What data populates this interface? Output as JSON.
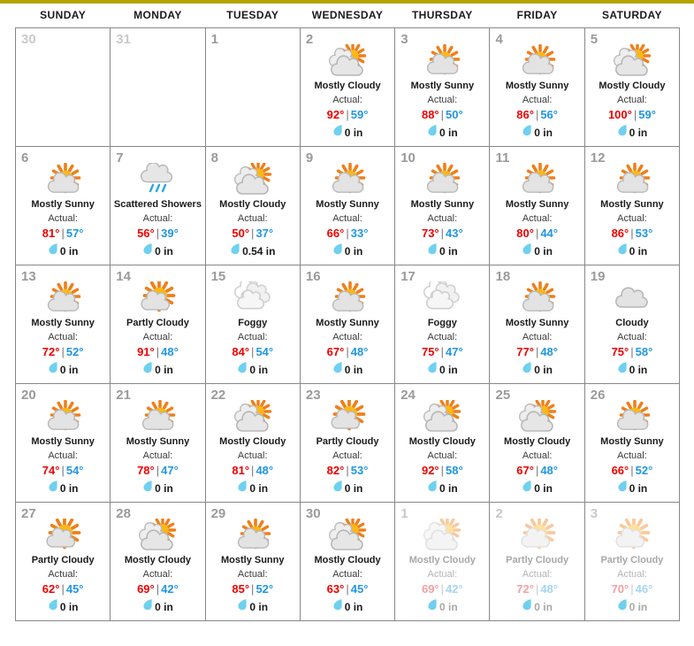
{
  "theme": {
    "topbar_color": "#b5a400",
    "high_temp_color": "#ee0000",
    "low_temp_color": "#2196e3",
    "muted_bg_color": "#eaeaea",
    "grid_border_color": "#888888"
  },
  "header": {
    "weekdays": [
      "SUNDAY",
      "MONDAY",
      "TUESDAY",
      "WEDNESDAY",
      "THURSDAY",
      "FRIDAY",
      "SATURDAY"
    ]
  },
  "labels": {
    "actual": "Actual:",
    "precip_unit": "in"
  },
  "weeks": [
    [
      {
        "day": "30",
        "muted": true,
        "empty": true
      },
      {
        "day": "31",
        "muted": true,
        "empty": true
      },
      {
        "day": "1",
        "muted": false,
        "empty": true
      },
      {
        "day": "2",
        "muted": false,
        "empty": false,
        "condition": "Mostly Cloudy",
        "icon": "mostly-cloudy-icon",
        "actual": "Actual:",
        "high": "92°",
        "low": "59°",
        "precip": "0 in"
      },
      {
        "day": "3",
        "muted": false,
        "empty": false,
        "condition": "Mostly Sunny",
        "icon": "mostly-sunny-icon",
        "actual": "Actual:",
        "high": "88°",
        "low": "50°",
        "precip": "0 in"
      },
      {
        "day": "4",
        "muted": false,
        "empty": false,
        "condition": "Mostly Sunny",
        "icon": "mostly-sunny-icon",
        "actual": "Actual:",
        "high": "86°",
        "low": "56°",
        "precip": "0 in"
      },
      {
        "day": "5",
        "muted": false,
        "empty": false,
        "condition": "Mostly Cloudy",
        "icon": "mostly-cloudy-icon",
        "actual": "Actual:",
        "high": "100°",
        "low": "59°",
        "precip": "0 in"
      }
    ],
    [
      {
        "day": "6",
        "muted": false,
        "empty": false,
        "condition": "Mostly Sunny",
        "icon": "mostly-sunny-icon",
        "actual": "Actual:",
        "high": "81°",
        "low": "57°",
        "precip": "0 in"
      },
      {
        "day": "7",
        "muted": false,
        "empty": false,
        "condition": "Scattered Showers",
        "icon": "scattered-showers-icon",
        "actual": "Actual:",
        "high": "56°",
        "low": "39°",
        "precip": "0 in"
      },
      {
        "day": "8",
        "muted": false,
        "empty": false,
        "condition": "Mostly Cloudy",
        "icon": "mostly-cloudy-icon",
        "actual": "Actual:",
        "high": "50°",
        "low": "37°",
        "precip": "0.54 in"
      },
      {
        "day": "9",
        "muted": false,
        "empty": false,
        "condition": "Mostly Sunny",
        "icon": "mostly-sunny-icon",
        "actual": "Actual:",
        "high": "66°",
        "low": "33°",
        "precip": "0 in"
      },
      {
        "day": "10",
        "muted": false,
        "empty": false,
        "condition": "Mostly Sunny",
        "icon": "mostly-sunny-icon",
        "actual": "Actual:",
        "high": "73°",
        "low": "43°",
        "precip": "0 in"
      },
      {
        "day": "11",
        "muted": false,
        "empty": false,
        "condition": "Mostly Sunny",
        "icon": "mostly-sunny-icon",
        "actual": "Actual:",
        "high": "80°",
        "low": "44°",
        "precip": "0 in"
      },
      {
        "day": "12",
        "muted": false,
        "empty": false,
        "condition": "Mostly Sunny",
        "icon": "mostly-sunny-icon",
        "actual": "Actual:",
        "high": "86°",
        "low": "53°",
        "precip": "0 in"
      }
    ],
    [
      {
        "day": "13",
        "muted": false,
        "empty": false,
        "condition": "Mostly Sunny",
        "icon": "mostly-sunny-icon",
        "actual": "Actual:",
        "high": "72°",
        "low": "52°",
        "precip": "0 in"
      },
      {
        "day": "14",
        "muted": false,
        "empty": false,
        "condition": "Partly Cloudy",
        "icon": "partly-cloudy-icon",
        "actual": "Actual:",
        "high": "91°",
        "low": "48°",
        "precip": "0 in"
      },
      {
        "day": "15",
        "muted": false,
        "empty": false,
        "condition": "Foggy",
        "icon": "foggy-icon",
        "actual": "Actual:",
        "high": "84°",
        "low": "54°",
        "precip": "0 in"
      },
      {
        "day": "16",
        "muted": false,
        "empty": false,
        "condition": "Mostly Sunny",
        "icon": "mostly-sunny-icon",
        "actual": "Actual:",
        "high": "67°",
        "low": "48°",
        "precip": "0 in"
      },
      {
        "day": "17",
        "muted": false,
        "empty": false,
        "condition": "Foggy",
        "icon": "foggy-icon",
        "actual": "Actual:",
        "high": "75°",
        "low": "47°",
        "precip": "0 in"
      },
      {
        "day": "18",
        "muted": false,
        "empty": false,
        "condition": "Mostly Sunny",
        "icon": "mostly-sunny-icon",
        "actual": "Actual:",
        "high": "77°",
        "low": "48°",
        "precip": "0 in"
      },
      {
        "day": "19",
        "muted": false,
        "empty": false,
        "condition": "Cloudy",
        "icon": "cloudy-icon",
        "actual": "Actual:",
        "high": "75°",
        "low": "58°",
        "precip": "0 in"
      }
    ],
    [
      {
        "day": "20",
        "muted": false,
        "empty": false,
        "condition": "Mostly Sunny",
        "icon": "mostly-sunny-icon",
        "actual": "Actual:",
        "high": "74°",
        "low": "54°",
        "precip": "0 in"
      },
      {
        "day": "21",
        "muted": false,
        "empty": false,
        "condition": "Mostly Sunny",
        "icon": "mostly-sunny-icon",
        "actual": "Actual:",
        "high": "78°",
        "low": "47°",
        "precip": "0 in"
      },
      {
        "day": "22",
        "muted": false,
        "empty": false,
        "condition": "Mostly Cloudy",
        "icon": "mostly-cloudy-icon",
        "actual": "Actual:",
        "high": "81°",
        "low": "48°",
        "precip": "0 in"
      },
      {
        "day": "23",
        "muted": false,
        "empty": false,
        "condition": "Partly Cloudy",
        "icon": "partly-cloudy-icon",
        "actual": "Actual:",
        "high": "82°",
        "low": "53°",
        "precip": "0 in"
      },
      {
        "day": "24",
        "muted": false,
        "empty": false,
        "condition": "Mostly Cloudy",
        "icon": "mostly-cloudy-icon",
        "actual": "Actual:",
        "high": "92°",
        "low": "58°",
        "precip": "0 in"
      },
      {
        "day": "25",
        "muted": false,
        "empty": false,
        "condition": "Mostly Cloudy",
        "icon": "mostly-cloudy-icon",
        "actual": "Actual:",
        "high": "67°",
        "low": "48°",
        "precip": "0 in"
      },
      {
        "day": "26",
        "muted": false,
        "empty": false,
        "condition": "Mostly Sunny",
        "icon": "mostly-sunny-icon",
        "actual": "Actual:",
        "high": "66°",
        "low": "52°",
        "precip": "0 in"
      }
    ],
    [
      {
        "day": "27",
        "muted": false,
        "empty": false,
        "condition": "Partly Cloudy",
        "icon": "partly-cloudy-icon",
        "actual": "Actual:",
        "high": "62°",
        "low": "45°",
        "precip": "0 in"
      },
      {
        "day": "28",
        "muted": false,
        "empty": false,
        "condition": "Mostly Cloudy",
        "icon": "mostly-cloudy-icon",
        "actual": "Actual:",
        "high": "69°",
        "low": "42°",
        "precip": "0 in"
      },
      {
        "day": "29",
        "muted": false,
        "empty": false,
        "condition": "Mostly Sunny",
        "icon": "mostly-sunny-icon",
        "actual": "Actual:",
        "high": "85°",
        "low": "52°",
        "precip": "0 in"
      },
      {
        "day": "30",
        "muted": false,
        "empty": false,
        "condition": "Mostly Cloudy",
        "icon": "mostly-cloudy-icon",
        "actual": "Actual:",
        "high": "63°",
        "low": "45°",
        "precip": "0 in"
      },
      {
        "day": "1",
        "muted": true,
        "empty": false,
        "condition": "Mostly Cloudy",
        "icon": "mostly-cloudy-icon",
        "actual": "Actual:",
        "high": "69°",
        "low": "42°",
        "precip": "0 in"
      },
      {
        "day": "2",
        "muted": true,
        "empty": false,
        "condition": "Partly Cloudy",
        "icon": "partly-cloudy-icon",
        "actual": "Actual:",
        "high": "72°",
        "low": "48°",
        "precip": "0 in"
      },
      {
        "day": "3",
        "muted": true,
        "empty": false,
        "condition": "Partly Cloudy",
        "icon": "partly-cloudy-icon",
        "actual": "Actual:",
        "high": "70°",
        "low": "46°",
        "precip": "0 in"
      }
    ]
  ]
}
